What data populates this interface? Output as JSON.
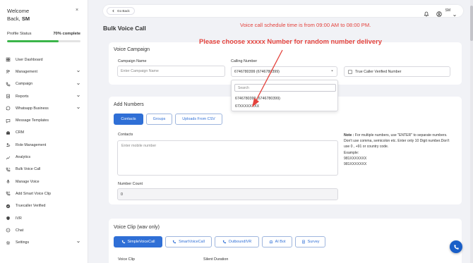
{
  "sidebar": {
    "welcome_line1": "Welcome",
    "welcome_line2_prefix": "Back, ",
    "welcome_user": "SM",
    "close_icon": "×",
    "profile_label": "Profile Status",
    "profile_percent": "70% complete",
    "profile_progress": 0.7,
    "items": [
      {
        "label": "User Dashboard",
        "icon": "grid-icon",
        "expandable": false
      },
      {
        "label": "Management",
        "icon": "users-icon",
        "expandable": true
      },
      {
        "label": "Campaign",
        "icon": "phone-icon",
        "expandable": true
      },
      {
        "label": "Reports",
        "icon": "report-icon",
        "expandable": true
      },
      {
        "label": "Whatsapp Business",
        "icon": "whatsapp-icon",
        "expandable": true
      },
      {
        "label": "Message Templates",
        "icon": "message-icon",
        "expandable": false
      },
      {
        "label": "CRM",
        "icon": "briefcase-icon",
        "expandable": false
      },
      {
        "label": "Role Management",
        "icon": "role-icon",
        "expandable": false
      },
      {
        "label": "Analytics",
        "icon": "analytics-icon",
        "expandable": false
      },
      {
        "label": "Bulk Voice Call",
        "icon": "voice-call-icon",
        "expandable": false
      },
      {
        "label": "Manage Voice",
        "icon": "mic-icon",
        "expandable": false
      },
      {
        "label": "Add Smart Voice Clip",
        "icon": "phone-plus-icon",
        "expandable": false
      },
      {
        "label": "Truecaller Verified",
        "icon": "verified-icon",
        "expandable": false
      },
      {
        "label": "IVR",
        "icon": "ivr-icon",
        "expandable": false
      },
      {
        "label": "Chat",
        "icon": "chat-icon",
        "expandable": false
      },
      {
        "label": "Settings",
        "icon": "gear-icon",
        "expandable": true
      }
    ]
  },
  "header": {
    "go_back": "Go Back",
    "user_name": "SM"
  },
  "page": {
    "title": "Bulk Voice Call",
    "schedule_notice": "Voice call schedule time is from 09:00 AM to 08:00 PM.",
    "annotation": "Please choose xxxxx Number for random number delivery"
  },
  "campaign": {
    "section_title": "Voice Campaign",
    "name_label": "Campaign Name",
    "name_placeholder": "Enter Campaign Name",
    "calling_label": "Calling Number",
    "calling_value": "6746780399 (6746780399)",
    "truecaller_label": "True Caller Verified Number",
    "dropdown": {
      "search_placeholder": "Search",
      "options": [
        "6746780399 (6746780399)",
        "67XXXXXXXX"
      ]
    }
  },
  "numbers": {
    "section_title": "Add Numbers",
    "tabs": [
      "Contacts",
      "Groups",
      "Uploads From CSV"
    ],
    "contacts_label": "Contacts",
    "contacts_placeholder": "Enter mobile number",
    "note_title": "Note :",
    "note_text": "For multiple numbers, use \"ENTER\" to separate numbers. Don't use comma, semicolon etc. Enter only 10 Digit number.Don't use 0 , +91 or country code.",
    "example_label": "Example:",
    "examples": [
      "981XXXXXXX",
      "981XXXXXXX"
    ],
    "count_label": "Number Count",
    "count_value": "0"
  },
  "voice_clip": {
    "section_title": "Voice Clip (wav only)",
    "buttons": [
      "SimpleVoiceCall",
      "SmartVoiceCall",
      "OutboundIVR",
      "AI Bot",
      "Survey"
    ],
    "voice_clip_label": "Voice Clip",
    "silent_duration_label": "Silent Duration"
  },
  "colors": {
    "accent": "#2f6fd6",
    "alert": "#e4423c",
    "progress": "#3bb54a"
  }
}
